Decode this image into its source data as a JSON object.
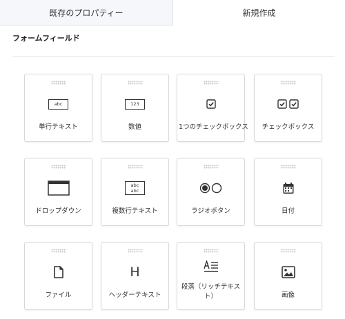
{
  "tabs": [
    {
      "label": "既存のプロパティー",
      "active": false
    },
    {
      "label": "新規作成",
      "active": true
    }
  ],
  "section_title": "フォームフィールド",
  "fields": [
    {
      "label": "単行テキスト",
      "icon": "single-line-text-icon",
      "icon_text": "abc"
    },
    {
      "label": "数値",
      "icon": "number-icon",
      "icon_text": "123"
    },
    {
      "label": "1つのチェックボックス",
      "icon": "single-checkbox-icon"
    },
    {
      "label": "チェックボックス",
      "icon": "checkboxes-icon"
    },
    {
      "label": "ドロップダウン",
      "icon": "dropdown-icon"
    },
    {
      "label": "複数行テキスト",
      "icon": "multi-line-text-icon",
      "icon_text_1": "abc",
      "icon_text_2": "abc"
    },
    {
      "label": "ラジオボタン",
      "icon": "radio-buttons-icon"
    },
    {
      "label": "日付",
      "icon": "calendar-icon"
    },
    {
      "label": "ファイル",
      "icon": "file-icon"
    },
    {
      "label": "ヘッダーテキスト",
      "icon": "header-text-icon",
      "icon_text": "H"
    },
    {
      "label": "段落（リッチテキスト）",
      "icon": "paragraph-icon"
    },
    {
      "label": "画像",
      "icon": "image-icon"
    }
  ],
  "colors": {
    "tab_inactive_bg": "#f5f7fa",
    "card_border": "#d7d7d7",
    "icon": "#333333"
  }
}
